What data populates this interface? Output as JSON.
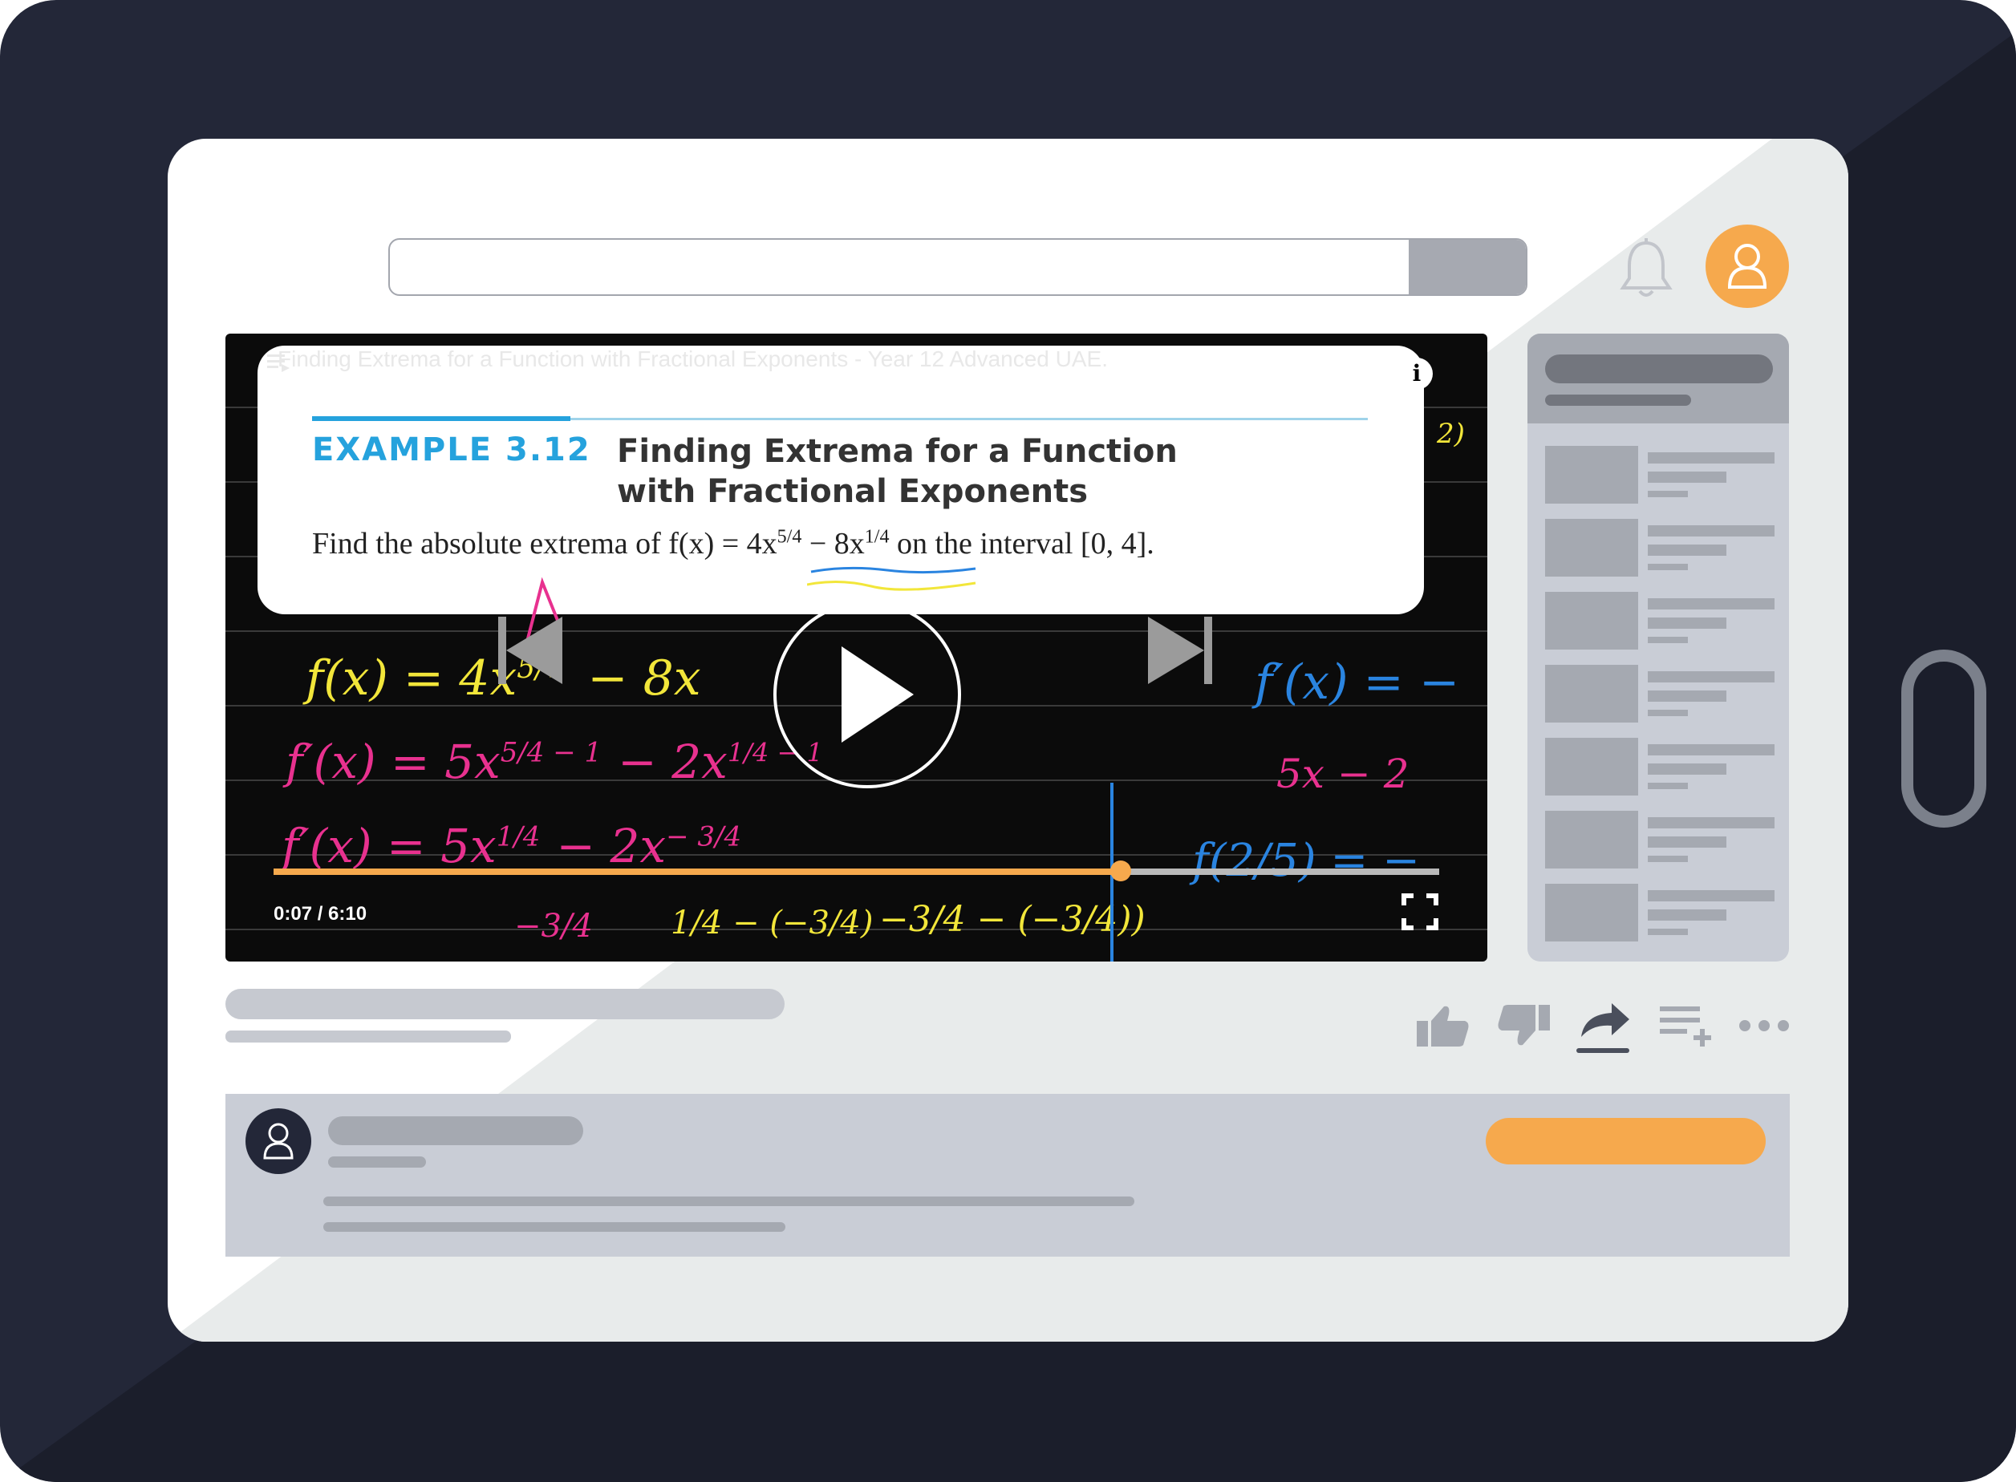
{
  "video": {
    "title": "Finding Extrema for a Function with Fractional Exponents - Year 12 Advanced UAE.",
    "example_label": "EXAMPLE 3.12",
    "example_title_line1": "Finding Extrema for a Function",
    "example_title_line2": "with Fractional Exponents",
    "problem_prefix": "Find the absolute extrema of f(x) = 4x",
    "problem_exp1": "5/4",
    "problem_mid": " − 8x",
    "problem_exp2": "1/4",
    "problem_suffix": " on the interval [0, 4].",
    "info_glyph": "i",
    "time": "0:07 / 6:10",
    "progress_fraction": 0.727,
    "board": {
      "line1": "f(x) = 4x",
      "line1_exp": "5/4",
      "line1_tail": "− 8x",
      "line2": "f′(x) = 5x",
      "line2_exp": "5/4 − 1",
      "line2_tail": "− 2x",
      "line2_tail_exp": "1/4 − 1",
      "line3": "f′(x) = 5x",
      "line3_exp": "1/4",
      "line3_tail": "− 2x",
      "line3_tail_exp": "− 3/4",
      "right1": "f′(x) = −",
      "right2": "5x − 2",
      "right3": "f(2/5) = −",
      "line4a": "−3/4",
      "line4b": "1/4 − (−3/4)",
      "line4c": "−3/4 − (−3/4))",
      "corner": "2)"
    }
  },
  "icons": {
    "bell": "bell-icon",
    "user": "user-icon",
    "thumb_up": "thumbs-up-icon",
    "thumb_down": "thumbs-down-icon",
    "share": "share-icon",
    "add_playlist": "add-to-playlist-icon",
    "more": "more-icon",
    "play": "play-icon",
    "previous": "previous-icon",
    "next": "next-icon",
    "fullscreen": "fullscreen-icon",
    "playlist": "playlist-icon",
    "info": "info-icon"
  },
  "colors": {
    "accent_orange": "#f6a94d",
    "device_frame": "#232738",
    "example_blue": "#25a2dd",
    "chalk_yellow": "#f2e63a",
    "chalk_pink": "#e8318f",
    "chalk_blue": "#2a84e0"
  }
}
